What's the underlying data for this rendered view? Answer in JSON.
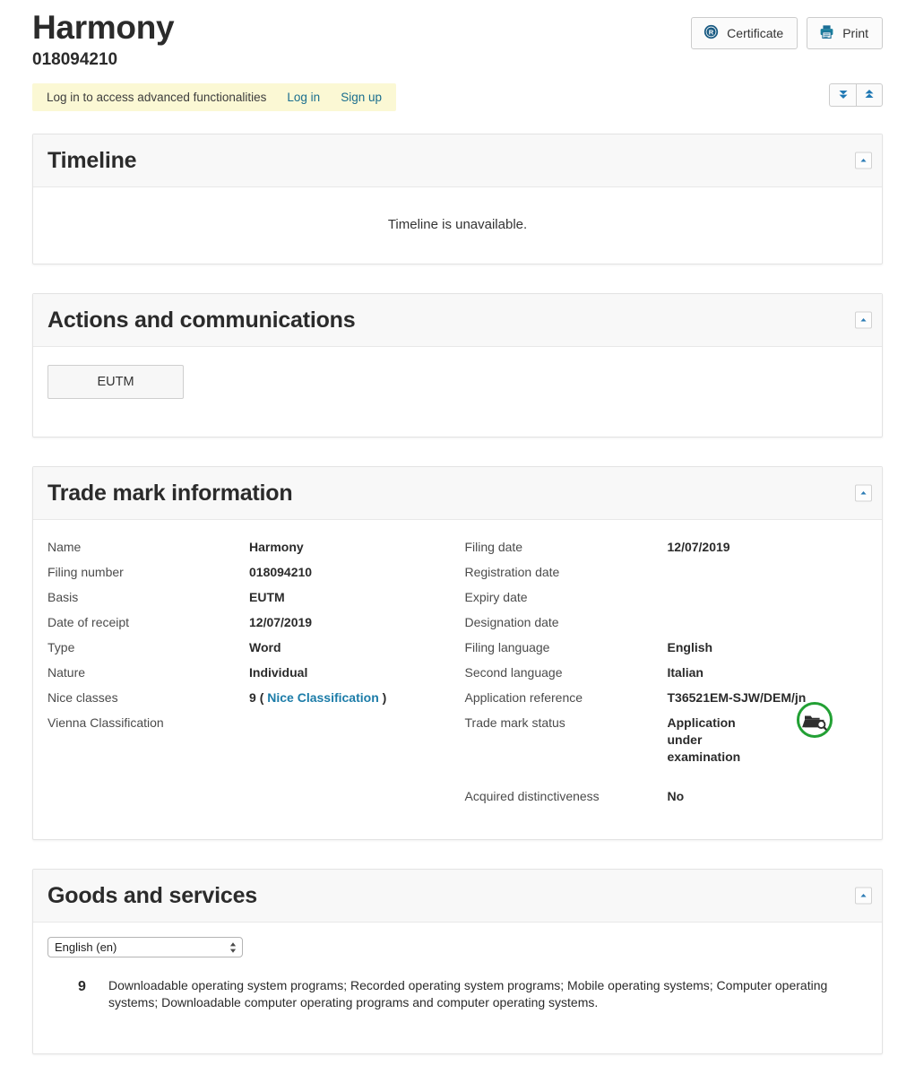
{
  "header": {
    "mark_name": "Harmony",
    "mark_number": "018094210",
    "certificate_label": "Certificate",
    "print_label": "Print",
    "certificate_icon": "registered-r-icon",
    "print_icon": "printer-icon",
    "expand_all_icon": "double-chevron-down-icon",
    "collapse_all_icon": "double-chevron-up-icon"
  },
  "notice": {
    "message": "Log in to access advanced functionalities",
    "login_label": "Log in",
    "signup_label": "Sign up"
  },
  "sections": {
    "timeline": {
      "title": "Timeline",
      "message": "Timeline is unavailable."
    },
    "actions": {
      "title": "Actions and communications",
      "button_label": "EUTM"
    },
    "trademark": {
      "title": "Trade mark information",
      "left": [
        {
          "label": "Name",
          "value": "Harmony"
        },
        {
          "label": "Filing number",
          "value": "018094210"
        },
        {
          "label": "Basis",
          "value": "EUTM"
        },
        {
          "label": "Date of receipt",
          "value": "12/07/2019"
        },
        {
          "label": "Type",
          "value": "Word"
        },
        {
          "label": "Nature",
          "value": "Individual"
        },
        {
          "label": "Nice classes",
          "value": "9",
          "link_prefix": "(",
          "link_text": "Nice Classification",
          "link_suffix": ")"
        },
        {
          "label": "Vienna Classification",
          "value": ""
        }
      ],
      "right": [
        {
          "label": "Filing date",
          "value": "12/07/2019"
        },
        {
          "label": "Registration date",
          "value": ""
        },
        {
          "label": "Expiry date",
          "value": ""
        },
        {
          "label": "Designation date",
          "value": ""
        },
        {
          "label": "Filing language",
          "value": "English"
        },
        {
          "label": "Second language",
          "value": "Italian"
        },
        {
          "label": "Application reference",
          "value": "T36521EM-SJW/DEM/jn"
        },
        {
          "label": "Trade mark status",
          "value": "Application under examination"
        },
        {
          "label": "Acquired distinctiveness",
          "value": "No"
        }
      ],
      "status_icon": "folder-search-icon",
      "status_icon_color": "#22a034"
    },
    "goods": {
      "title": "Goods and services",
      "language_selected": "English (en)",
      "language_options": [
        "English (en)"
      ],
      "entries": [
        {
          "class": "9",
          "text": "Downloadable operating system programs; Recorded operating system programs; Mobile operating systems; Computer operating systems; Downloadable computer operating programs and computer operating systems."
        }
      ]
    }
  },
  "colors": {
    "link": "#1a6e8e",
    "accent_link": "#1c7ca8",
    "notice_bg": "#fbf8d4",
    "panel_head_bg": "#f8f8f8",
    "icon_blue": "#1b6e96",
    "status_green": "#22a034"
  }
}
